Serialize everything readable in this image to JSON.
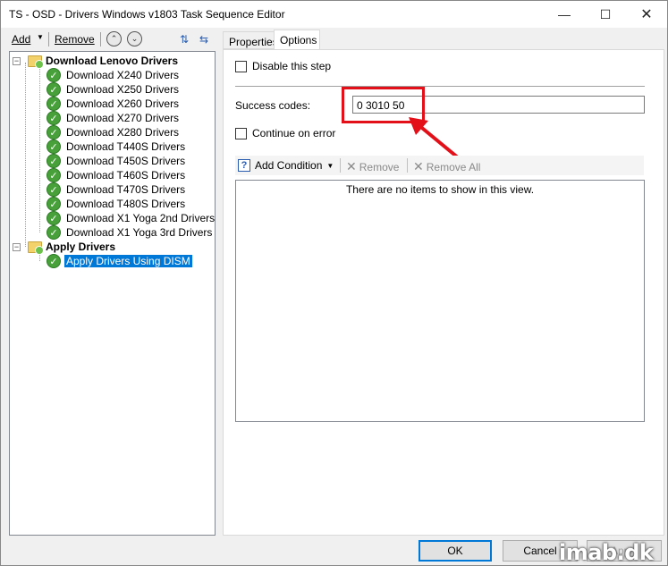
{
  "window": {
    "title": "TS - OSD - Drivers Windows v1803 Task Sequence Editor",
    "minimize_glyph": "—",
    "maximize_glyph": "☐",
    "close_glyph": "✕"
  },
  "left_toolbar": {
    "add_label": "Add",
    "remove_label": "Remove",
    "move_up_icon": "move-up-icon",
    "move_down_icon": "move-down-icon"
  },
  "tree": {
    "groups": [
      {
        "label": "Download Lenovo Drivers",
        "items": [
          "Download X240 Drivers",
          "Download X250 Drivers",
          "Download X260 Drivers",
          "Download X270 Drivers",
          "Download X280 Drivers",
          "Download T440S Drivers",
          "Download T450S Drivers",
          "Download T460S Drivers",
          "Download T470S Drivers",
          "Download T480S Drivers",
          "Download X1 Yoga 2nd Drivers",
          "Download X1 Yoga 3rd Drivers"
        ]
      },
      {
        "label": "Apply Drivers",
        "items": [
          "Apply Drivers Using DISM"
        ]
      }
    ],
    "selected_item": "Apply Drivers Using DISM"
  },
  "tabs": [
    {
      "label": "Properties",
      "active": false
    },
    {
      "label": "Options",
      "active": true
    }
  ],
  "options": {
    "disable_step_label": "Disable this step",
    "disable_step_checked": false,
    "success_codes_label": "Success codes:",
    "success_codes_value": "0 3010 50",
    "continue_on_error_label": "Continue on error",
    "continue_on_error_checked": false
  },
  "conditions": {
    "add_condition_label": "Add Condition",
    "remove_label": "Remove",
    "remove_all_label": "Remove All",
    "empty_message": "There are no items to show in this view."
  },
  "buttons": {
    "ok": "OK",
    "cancel": "Cancel",
    "apply": "Apply"
  },
  "annotation": {
    "highlight_color": "#e3101a"
  },
  "watermark": "imab.dk",
  "colors": {
    "selection": "#0078d7",
    "success_green": "#47a03a",
    "folder_yellow": "#f3d16b"
  }
}
